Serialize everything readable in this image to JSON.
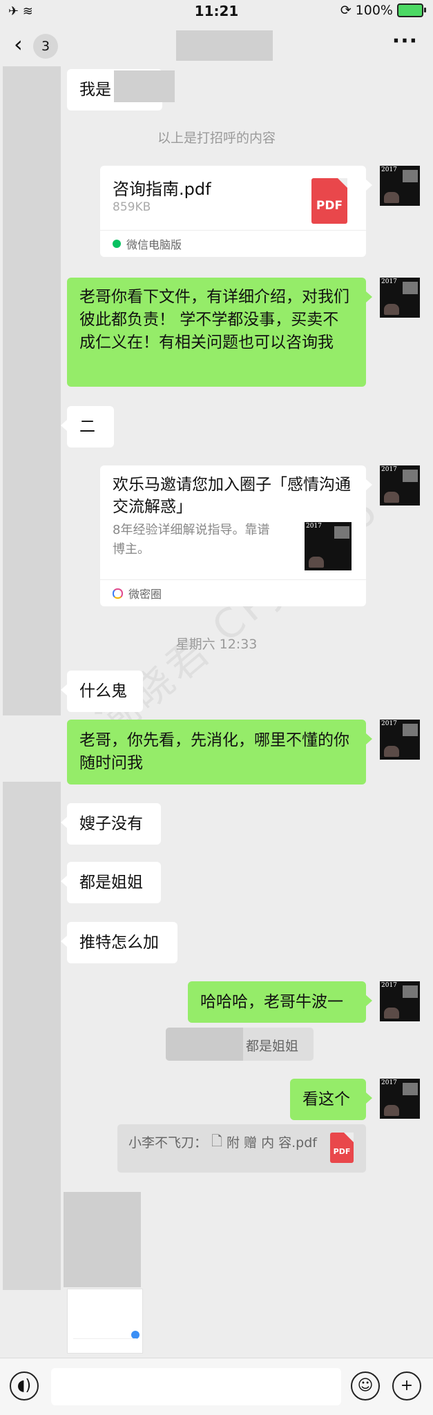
{
  "status_bar": {
    "time": "11:21",
    "left_icons": "✈ ≋",
    "battery": "100%"
  },
  "header": {
    "back_icon": "chevron-left-icon",
    "unread_count": "3",
    "more_icon": "more-icon"
  },
  "messages": {
    "m1": {
      "text": "我是"
    },
    "sys1": "以上是打招呼的内容",
    "file1": {
      "name": "咨询指南.pdf",
      "size": "859KB",
      "source": "微信电脑版",
      "badge": "PDF"
    },
    "m2": {
      "text": "老哥你看下文件，有详细介绍，对我们彼此都负责！ 学不学都没事，买卖不成仁义在！有相关问题也可以咨询我"
    },
    "m3": {
      "text": "二"
    },
    "invite": {
      "title": "欢乐马邀请您加入圈子「感情沟通交流解惑」",
      "desc": "8年经验详细解说指导。靠谱博主。",
      "source": "微密圈"
    },
    "sys2": "星期六 12:33",
    "m4": {
      "text": "什么鬼"
    },
    "m5": {
      "text": "老哥，你先看，先消化，哪里不懂的你随时问我"
    },
    "m6": {
      "text": "嫂子没有"
    },
    "m7": {
      "text": "都是姐姐"
    },
    "m8": {
      "text": "推特怎么加"
    },
    "m9": {
      "text": "哈哈哈，老哥牛波一"
    },
    "quote1": {
      "text": "都是姐姐"
    },
    "m10": {
      "text": "看这个"
    },
    "quote2": {
      "text": "小李不飞刀：",
      "file": "附 赠 内 容.pdf",
      "badge": "PDF"
    }
  },
  "avatar_year": "2017",
  "watermark": "潮晓君 CPJDR66",
  "input_bar": {
    "voice_icon": "voice-icon",
    "emoji_icon": "emoji-icon",
    "plus_icon": "plus-icon"
  },
  "colors": {
    "background": "#ededed",
    "sent_bubble": "#95ec69",
    "received_bubble": "#ffffff",
    "pdf_red": "#e9474b"
  }
}
